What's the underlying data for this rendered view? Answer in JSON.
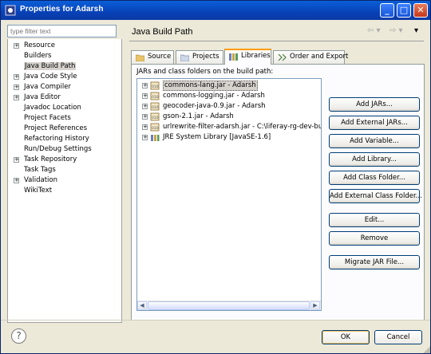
{
  "window": {
    "title": "Properties for Adarsh",
    "minimize": "_",
    "maximize": "□",
    "close": "✕"
  },
  "filter": {
    "placeholder": "type filter text"
  },
  "nav": {
    "items": [
      {
        "label": "Resource",
        "expandable": true
      },
      {
        "label": "Builders",
        "expandable": false
      },
      {
        "label": "Java Build Path",
        "expandable": false,
        "selected": true
      },
      {
        "label": "Java Code Style",
        "expandable": true
      },
      {
        "label": "Java Compiler",
        "expandable": true
      },
      {
        "label": "Java Editor",
        "expandable": true
      },
      {
        "label": "Javadoc Location",
        "expandable": false
      },
      {
        "label": "Project Facets",
        "expandable": false
      },
      {
        "label": "Project References",
        "expandable": false
      },
      {
        "label": "Refactoring History",
        "expandable": false
      },
      {
        "label": "Run/Debug Settings",
        "expandable": false
      },
      {
        "label": "Task Repository",
        "expandable": true
      },
      {
        "label": "Task Tags",
        "expandable": false
      },
      {
        "label": "Validation",
        "expandable": true
      },
      {
        "label": "WikiText",
        "expandable": false
      }
    ]
  },
  "page": {
    "title": "Java Build Path",
    "back_arrow": "⇦ ▾",
    "forward_arrow": "⇨ ▾",
    "menu_arrow": "▾"
  },
  "tabs": [
    {
      "label": "Source",
      "icon": "source-folder-icon"
    },
    {
      "label": "Projects",
      "icon": "projects-icon"
    },
    {
      "label": "Libraries",
      "icon": "libraries-icon",
      "active": true
    },
    {
      "label": "Order and Export",
      "icon": "order-export-icon"
    }
  ],
  "libraries": {
    "label": "JARs and class folders on the build path:",
    "entries": [
      {
        "label": "commons-lang.jar - Adarsh",
        "icon": "jar-icon",
        "selected": true
      },
      {
        "label": "commons-logging.jar - Adarsh",
        "icon": "jar-icon"
      },
      {
        "label": "geocoder-java-0.9.jar - Adarsh",
        "icon": "jar-icon"
      },
      {
        "label": "gson-2.1.jar - Adarsh",
        "icon": "jar-icon"
      },
      {
        "label": "urlrewrite-filter-adarsh.jar - C:\\liferay-rg-dev-bundle\\li",
        "icon": "jar-icon"
      },
      {
        "label": "JRE System Library [JavaSE-1.6]",
        "icon": "library-icon"
      }
    ]
  },
  "buttons": {
    "add_jars": "Add JARs...",
    "add_external_jars": "Add External JARs...",
    "add_variable": "Add Variable...",
    "add_library": "Add Library...",
    "add_class_folder": "Add Class Folder...",
    "add_external_class_folder": "Add External Class Folder...",
    "edit": "Edit...",
    "remove": "Remove",
    "migrate_jar": "Migrate JAR File..."
  },
  "footer": {
    "help": "?",
    "ok": "OK",
    "cancel": "Cancel"
  },
  "colors": {
    "titlebar": "#0a4fcc",
    "tab_accent": "#ff9b00",
    "selection": "#d6d3ce"
  }
}
